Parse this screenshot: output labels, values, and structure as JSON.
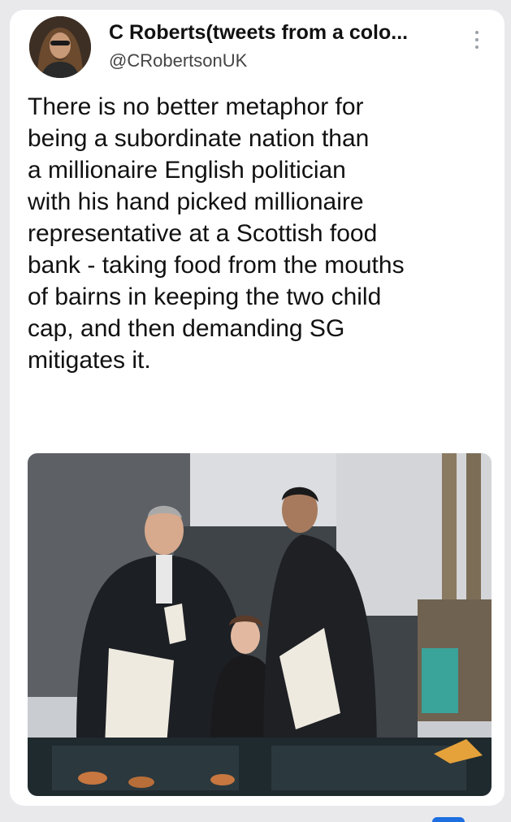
{
  "tweet": {
    "display_name": "C Roberts(tweets from a colo...",
    "handle": "@CRobertsonUK",
    "text": "There is no better metaphor for\nbeing a subordinate nation than\na millionaire English politician\nwith his hand picked millionaire\nrepresentative at a Scottish food\nbank - taking food from the mouths\nof bairns in keeping the two child\ncap, and then demanding SG\nmitigates it.",
    "avatar_icon": "profile-avatar",
    "more_icon": "more-vertical-icon"
  },
  "colors": {
    "background": "#e9e9ec",
    "card": "#ffffff",
    "text": "#111111",
    "handle": "#444444",
    "accent": "#1d6fe0"
  }
}
